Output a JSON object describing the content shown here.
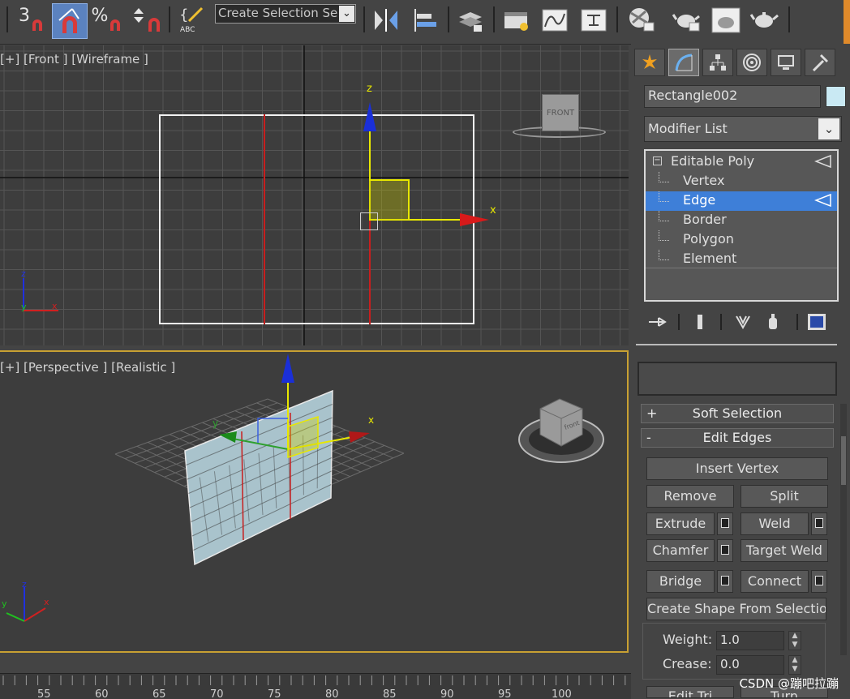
{
  "toolbar": {
    "snap_label": "3",
    "percent_label": "%",
    "abc_label": "ABC",
    "selection_set": {
      "placeholder": "Create Selection Se"
    }
  },
  "viewport_front": {
    "label": "[+] [Front ] [Wireframe ]",
    "viewcube_label": "FRONT",
    "axis_z": "z",
    "axis_x": "x"
  },
  "viewport_perspective": {
    "label": "[+] [Perspective ] [Realistic ]",
    "viewcube_label": "front",
    "axis_z": "z",
    "axis_x": "x",
    "axis_y": "y"
  },
  "command_panel": {
    "object_name": "Rectangle002",
    "object_color": "#c9e9f3",
    "modifier_list": "Modifier List",
    "stack": {
      "root": "Editable Poly",
      "items": [
        "Vertex",
        "Edge",
        "Border",
        "Polygon",
        "Element"
      ],
      "selected": "Edge"
    },
    "rollouts": {
      "soft_selection": {
        "symbol": "+",
        "title": "Soft Selection"
      },
      "edit_edges": {
        "symbol": "-",
        "title": "Edit Edges"
      }
    },
    "buttons": {
      "insert_vertex": "Insert Vertex",
      "remove": "Remove",
      "split": "Split",
      "extrude": "Extrude",
      "weld": "Weld",
      "chamfer": "Chamfer",
      "target_weld": "Target Weld",
      "bridge": "Bridge",
      "connect": "Connect",
      "create_shape": "Create Shape From Selection",
      "edit_tri": "Edit Tri",
      "turn": "Turn"
    },
    "weight": {
      "label": "Weight:",
      "value": "1.0"
    },
    "crease": {
      "label": "Crease:",
      "value": "0.0"
    }
  },
  "timeline": {
    "ticks": [
      "55",
      "60",
      "65",
      "70",
      "75",
      "80",
      "85",
      "90",
      "95",
      "100"
    ]
  },
  "watermark": "CSDN @蹦吧拉蹦",
  "colors": {
    "accent": "#3e7fd8",
    "active_border": "#c8a032",
    "background": "#444444"
  }
}
